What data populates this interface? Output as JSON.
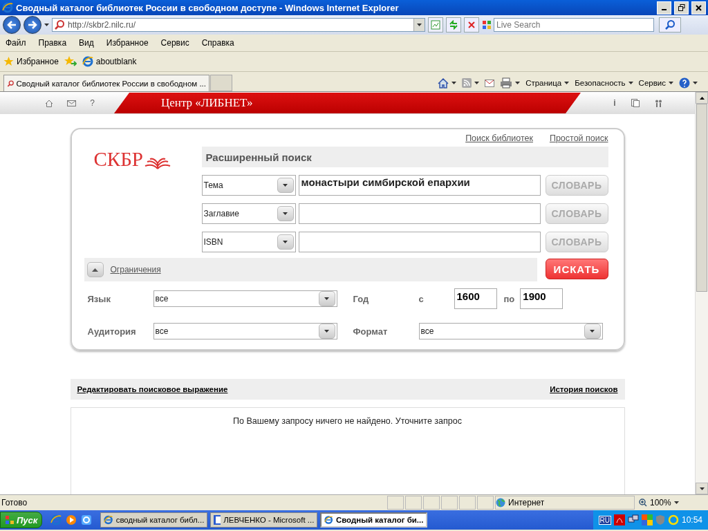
{
  "window": {
    "title": "Сводный каталог библиотек России в свободном доступе - Windows Internet Explorer"
  },
  "address": {
    "url": "http://skbr2.nilc.ru/"
  },
  "search": {
    "placeholder": "Live Search"
  },
  "menu": [
    "Файл",
    "Правка",
    "Вид",
    "Избранное",
    "Сервис",
    "Справка"
  ],
  "favorites": {
    "label": "Избранное",
    "links": [
      "aboutblank"
    ]
  },
  "tabs": [
    {
      "label": "Сводный каталог библиотек России в свободном ...",
      "selected": true
    }
  ],
  "command_bar": [
    "Страница",
    "Безопасность",
    "Сервис"
  ],
  "page": {
    "banner": {
      "help_glyph": "?",
      "title": "Центр «ЛИБНЕТ»",
      "info_glyph": "i"
    },
    "top_links": [
      "Поиск библиотек",
      "Простой поиск"
    ],
    "logo": "СКБР",
    "heading": "Расширенный поиск",
    "search_rows": [
      {
        "field": "Тема",
        "value": "монастыри симбирской епархии",
        "dictionary": "СЛОВАРЬ"
      },
      {
        "field": "Заглавие",
        "value": "",
        "dictionary": "СЛОВАРЬ"
      },
      {
        "field": "ISBN",
        "value": "",
        "dictionary": "СЛОВАРЬ"
      }
    ],
    "restrictions": {
      "label": "Ограничения",
      "expanded": true
    },
    "search_button": "ИСКАТЬ",
    "language": {
      "label": "Язык",
      "value": "все"
    },
    "year": {
      "label": "Год",
      "from_label": "с",
      "from": "1600",
      "to_label": "по",
      "to": "1900"
    },
    "audience": {
      "label": "Аудитория",
      "value": "все"
    },
    "format": {
      "label": "Формат",
      "value": "все"
    },
    "results_bar": {
      "edit_link": "Редактировать поисковое выражение",
      "history_link": "История поисков"
    },
    "message": "По Вашему запросу ничего не найдено. Уточните запрос"
  },
  "status_bar": {
    "text": "Готово",
    "zone": "Интернет",
    "zoom": "100%"
  },
  "taskbar": {
    "start": "Пуск",
    "tasks": [
      {
        "label": "сводный каталог библ...",
        "kind": "ie",
        "selected": false
      },
      {
        "label": "ЛЕВЧЕНКО - Microsoft ...",
        "kind": "word",
        "selected": false
      },
      {
        "label": "Сводный каталог би...",
        "kind": "ie",
        "selected": true
      }
    ],
    "language": "RU",
    "time": "10:54"
  }
}
